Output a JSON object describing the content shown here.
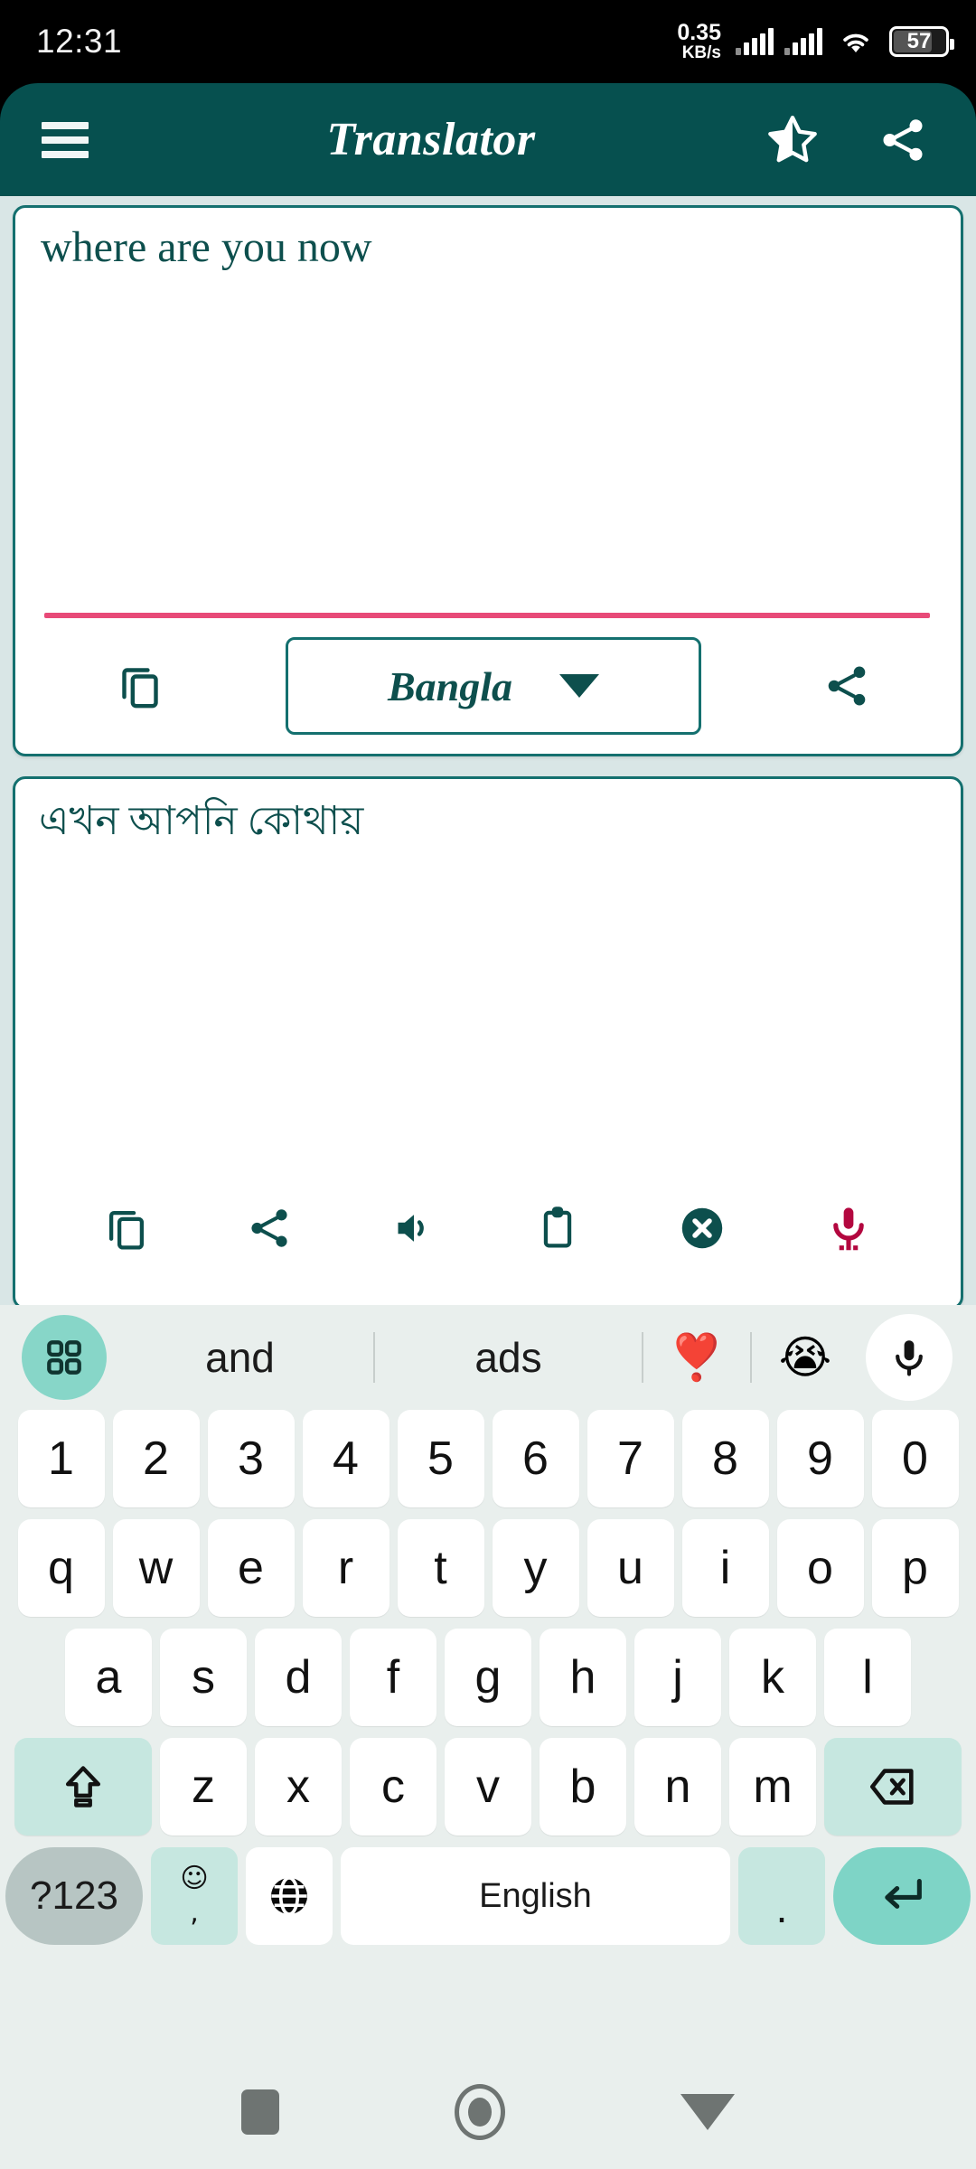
{
  "status_bar": {
    "time": "12:31",
    "net_speed_value": "0.35",
    "net_speed_unit": "KB/s",
    "battery_percent": "57",
    "icons": [
      "signal-bars-icon",
      "signal-bars-icon",
      "wifi-icon",
      "battery-icon"
    ]
  },
  "app_bar": {
    "menu_icon": "hamburger-menu-icon",
    "title": "Translator",
    "favorite_icon": "half-star-icon",
    "share_icon": "share-icon",
    "background": "#06504f"
  },
  "input_card": {
    "text": "where are you now",
    "divider_color": "#e84a78",
    "copy_icon": "copy-icon",
    "language": "Bangla",
    "dropdown_icon": "chevron-down-icon",
    "share_icon": "share-icon"
  },
  "output_card": {
    "text": "এখন আপনি কোথায়",
    "actions": [
      {
        "name": "copy-icon",
        "label": "Copy"
      },
      {
        "name": "share-icon",
        "label": "Share"
      },
      {
        "name": "speaker-icon",
        "label": "Speak"
      },
      {
        "name": "clipboard-icon",
        "label": "Paste"
      },
      {
        "name": "clear-circle-icon",
        "label": "Clear"
      },
      {
        "name": "microphone-icon",
        "label": "Voice input"
      }
    ],
    "mic_color": "#b3073f"
  },
  "keyboard": {
    "suggestions": {
      "grid_icon": "apps-grid-icon",
      "word_1": "and",
      "word_2": "ads",
      "emoji_1": "❣️",
      "emoji_2": "😭",
      "mic_icon": "microphone-icon"
    },
    "row_numbers": [
      "1",
      "2",
      "3",
      "4",
      "5",
      "6",
      "7",
      "8",
      "9",
      "0"
    ],
    "row_top": [
      "q",
      "w",
      "e",
      "r",
      "t",
      "y",
      "u",
      "i",
      "o",
      "p"
    ],
    "row_home": [
      "a",
      "s",
      "d",
      "f",
      "g",
      "h",
      "j",
      "k",
      "l"
    ],
    "row_bottom": [
      "z",
      "x",
      "c",
      "v",
      "b",
      "n",
      "m"
    ],
    "shift_icon": "shift-up-arrow-icon",
    "backspace_icon": "backspace-icon",
    "symbols_key": "?123",
    "emoji_key_glyph": "☺",
    "emoji_key_comma": ",",
    "globe_icon": "globe-language-icon",
    "spacebar_label": "English",
    "period_key": ".",
    "enter_icon": "enter-return-icon",
    "accent": "#7ed4c6",
    "key_bg": "#ffffff",
    "board_bg": "#e9efed"
  },
  "nav_bar": {
    "recents_icon": "recents-square-icon",
    "home_icon": "home-circle-icon",
    "back_icon": "back-triangle-icon"
  },
  "theme": {
    "primary": "#06504f",
    "surface": "#d9e6e6",
    "card_border": "#14706f",
    "text": "#0d4f4d"
  }
}
